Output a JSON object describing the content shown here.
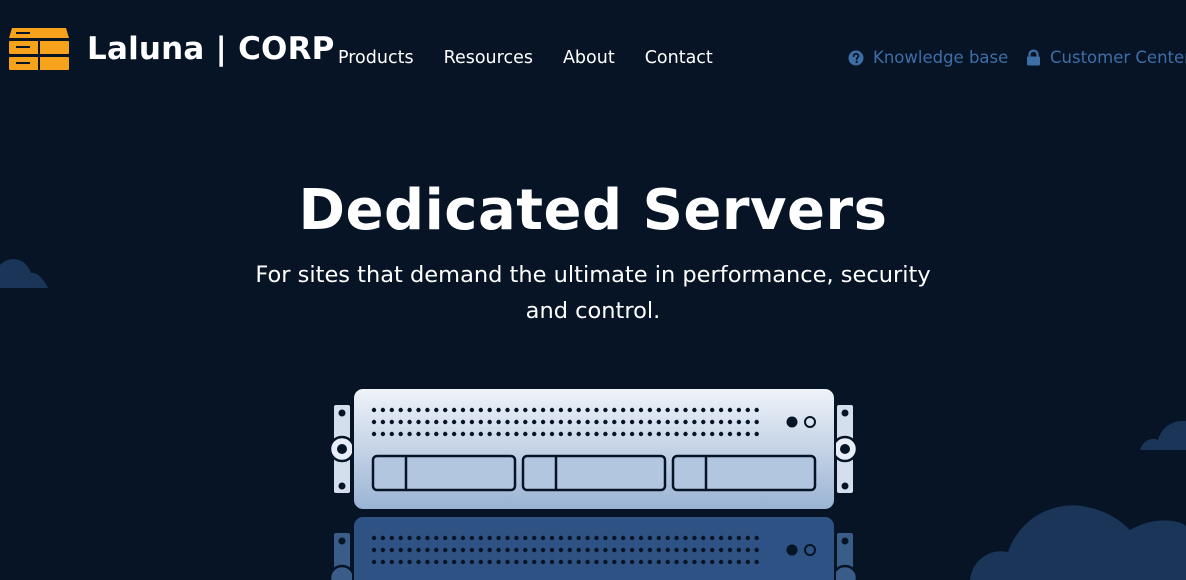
{
  "header": {
    "brand": "Laluna | CORP",
    "logo_icon": "server-stack-logo-icon",
    "nav": [
      {
        "label": "Products"
      },
      {
        "label": "Resources"
      },
      {
        "label": "About"
      },
      {
        "label": "Contact"
      }
    ],
    "utility": {
      "knowledge_base": {
        "label": "Knowledge base",
        "icon": "question-circle-icon"
      },
      "customer_center": {
        "label": "Customer Center",
        "icon": "lock-icon"
      }
    }
  },
  "hero": {
    "title": "Dedicated Servers",
    "subtitle": "For sites that demand the ultimate in performance, security and control."
  },
  "colors": {
    "background": "#061426",
    "text": "#ffffff",
    "utility_link": "#3e6ea6",
    "logo_accent": "#f6a21a",
    "cloud": "#1b3558",
    "server_face": "#c8d6ea"
  }
}
